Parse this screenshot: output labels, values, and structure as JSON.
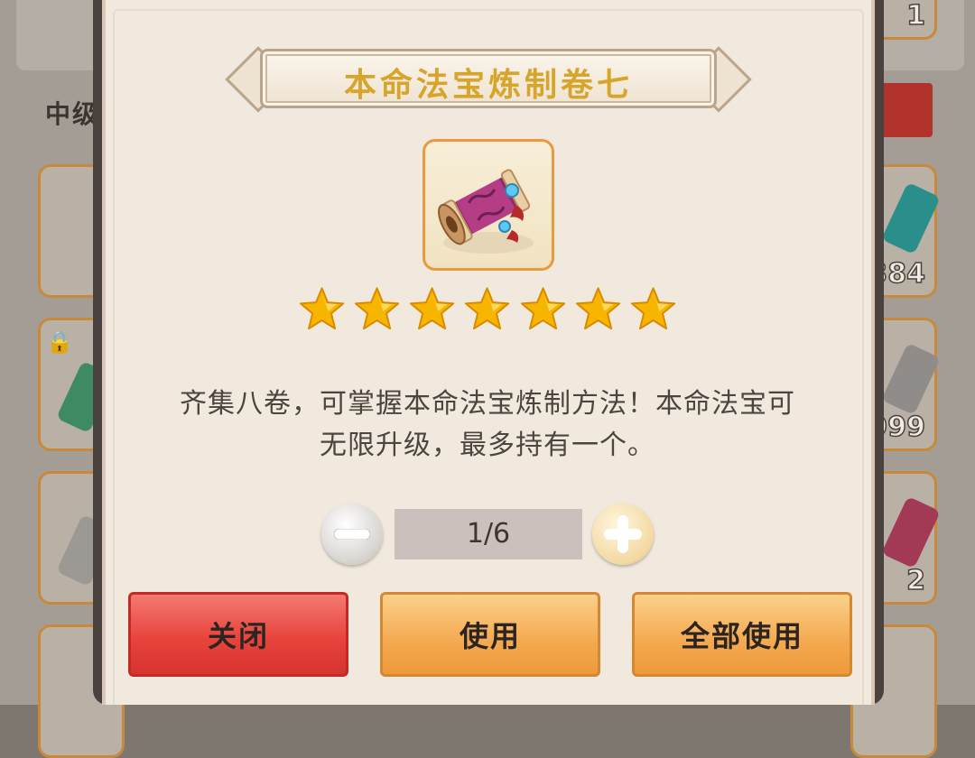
{
  "dialog": {
    "title": "本命法宝炼制卷七",
    "item_icon": "scroll-item-icon",
    "star_count": 7,
    "description_line1": "齐集八卷，可掌握本命法宝炼制方法！本命法宝可",
    "description_line2": "无限升级，最多持有一个。",
    "quantity": "1/6",
    "buttons": {
      "close": "关闭",
      "use": "使用",
      "use_all": "全部使用"
    },
    "colors": {
      "title": "#d7a52c",
      "star": "#f7b500",
      "close_button": "#e8443d",
      "use_button": "#f4a94f"
    }
  },
  "background": {
    "header_text": "中级",
    "counts": [
      "1",
      "384",
      "999",
      "2"
    ]
  }
}
